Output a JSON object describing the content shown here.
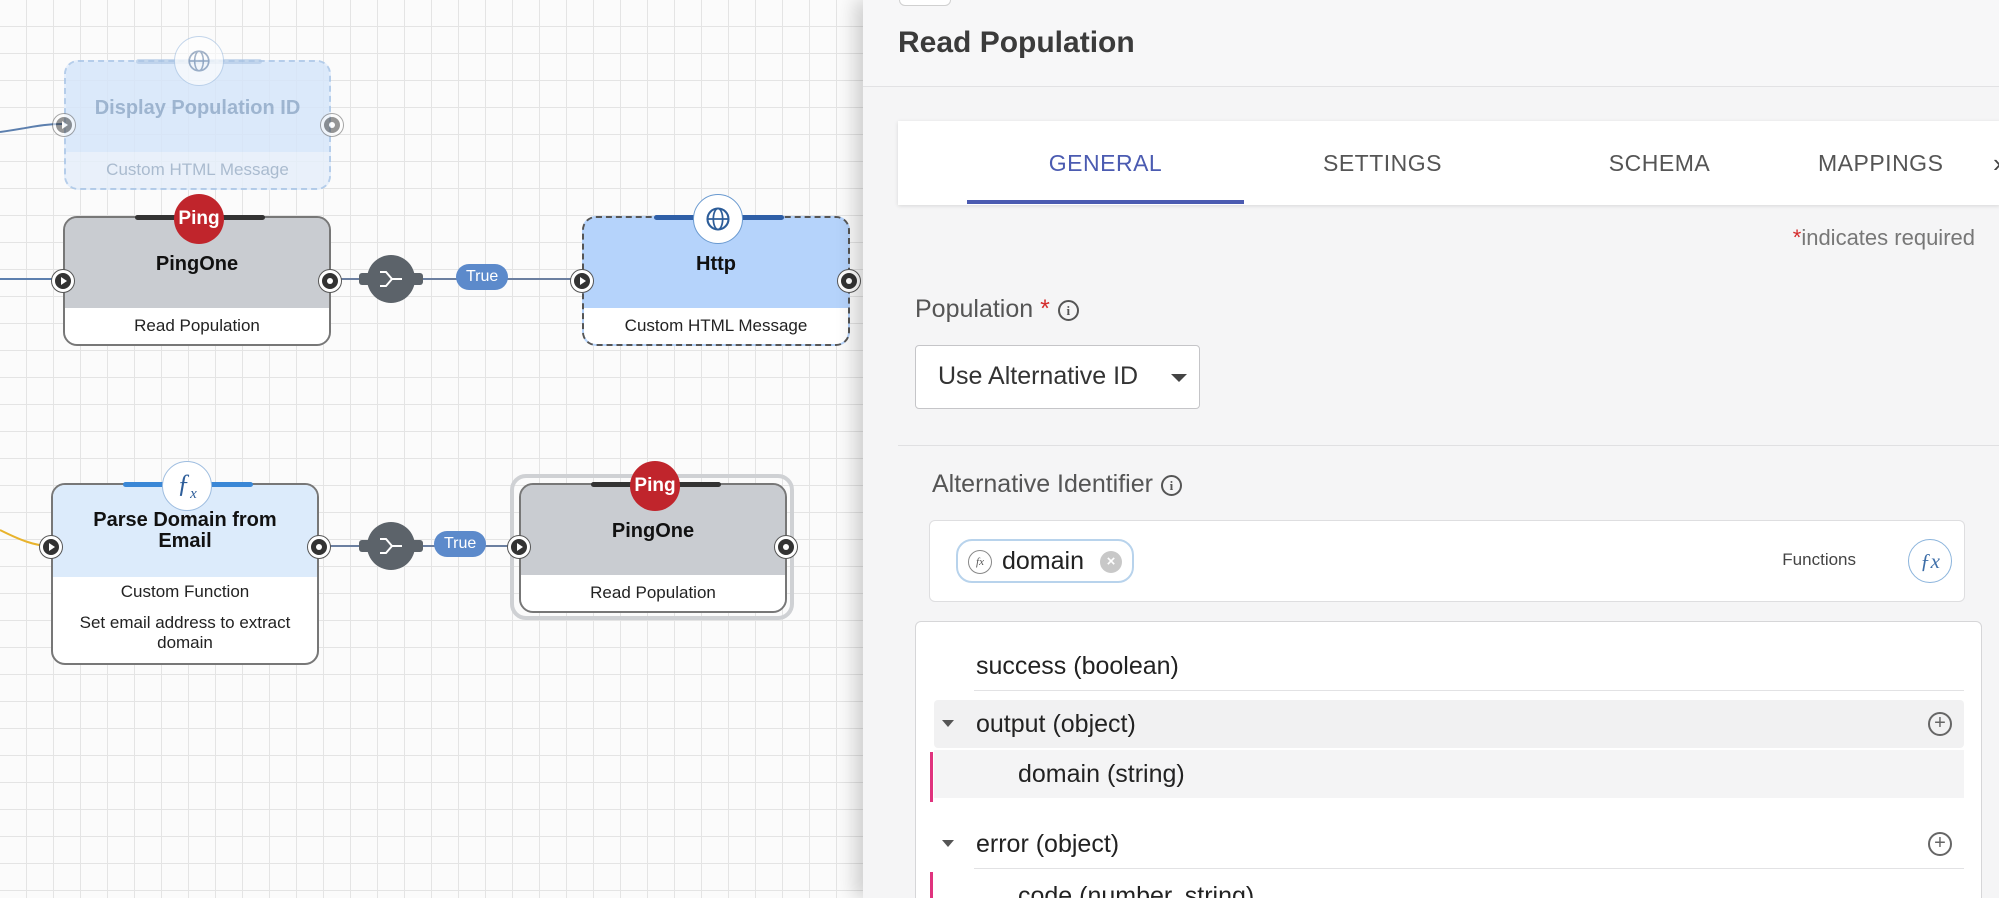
{
  "canvas": {
    "nodes": [
      {
        "id": "display-population-id",
        "title": "Display Population ID",
        "subtitle": "Custom HTML Message",
        "icon": "globe-icon",
        "state": "disabled"
      },
      {
        "id": "pingone-1",
        "title": "PingOne",
        "subtitle": "Read Population",
        "icon": "ping-logo",
        "badge": "Ping"
      },
      {
        "id": "http",
        "title": "Http",
        "subtitle": "Custom HTML Message",
        "icon": "globe-icon",
        "state": "selected"
      },
      {
        "id": "parse-domain",
        "title": "Parse Domain from Email",
        "subtitle": "Custom Function",
        "description": "Set email address to extract domain",
        "icon": "fx-icon"
      },
      {
        "id": "pingone-2",
        "title": "PingOne",
        "subtitle": "Read Population",
        "icon": "ping-logo",
        "badge": "Ping",
        "state": "active"
      }
    ],
    "edge_labels": [
      "True",
      "True"
    ]
  },
  "panel": {
    "title": "Read Population",
    "tabs": [
      "GENERAL",
      "SETTINGS",
      "SCHEMA",
      "MAPPINGS"
    ],
    "active_tab": "GENERAL",
    "required_star": "*",
    "required_note": "indicates required",
    "population": {
      "label": "Population",
      "required_marker": "*",
      "value": "Use Alternative ID"
    },
    "alternative_identifier": {
      "label": "Alternative Identifier",
      "chip": "domain",
      "functions_label": "Functions"
    },
    "schema_tree": [
      {
        "label": "success (boolean)",
        "level": 0,
        "expandable": false
      },
      {
        "label": "output (object)",
        "level": 0,
        "expandable": true,
        "expanded": true
      },
      {
        "label": "domain (string)",
        "level": 1
      },
      {
        "label": "error (object)",
        "level": 0,
        "expandable": true,
        "expanded": true
      },
      {
        "label": "code (number, string)",
        "level": 1
      }
    ]
  },
  "colors": {
    "accent": "#4b5bb1",
    "ping_red": "#c0252c",
    "required": "#d42b2b",
    "tree_line": "#e0337e",
    "true_pill": "#5c8acb"
  }
}
